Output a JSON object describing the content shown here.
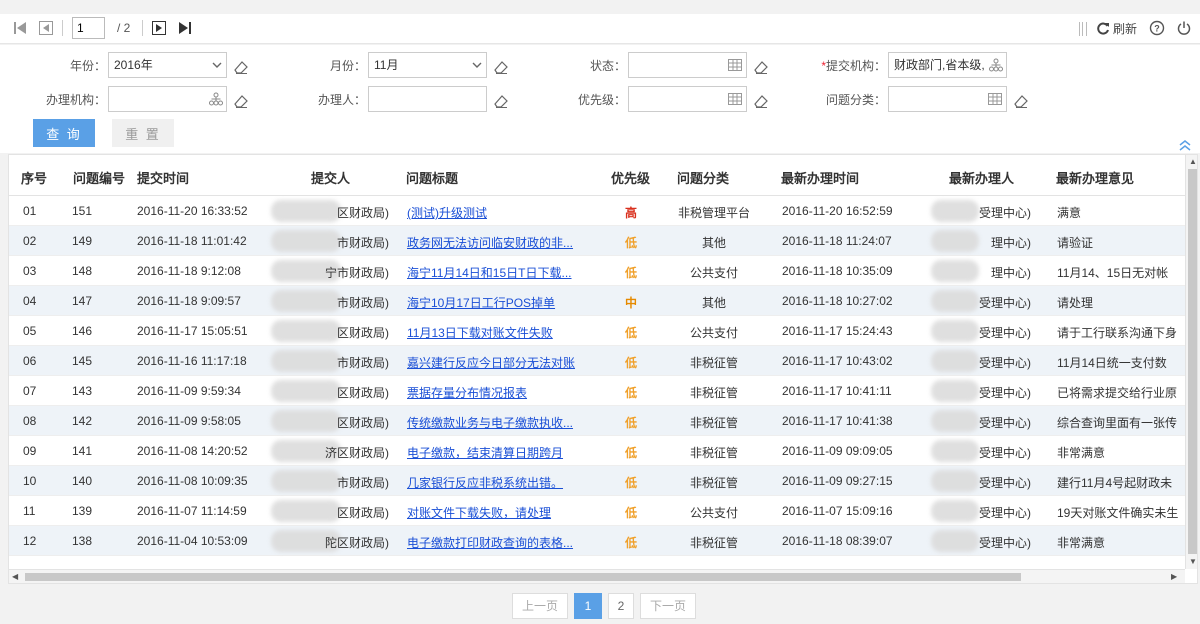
{
  "toolbar": {
    "page_current": "1",
    "page_total": "/ 2",
    "refresh_label": "刷新"
  },
  "filters": {
    "year_label": "年份：",
    "year_value": "2016年",
    "month_label": "月份：",
    "month_value": "11月",
    "status_label": "状态：",
    "status_value": "",
    "submit_org_label": "*提交机构：",
    "submit_org_value": "财政部门,省本级,丿",
    "handle_org_label": "办理机构：",
    "handle_org_value": "",
    "handler_label": "办理人：",
    "handler_value": "",
    "priority_label": "优先级：",
    "priority_value": "",
    "category_label": "问题分类：",
    "category_value": "",
    "query_button": "查 询",
    "reset_button": "重 置"
  },
  "table": {
    "headers": [
      "序号",
      "问题编号",
      "提交时间",
      "提交人",
      "问题标题",
      "优先级",
      "问题分类",
      "最新办理时间",
      "最新办理人",
      "最新办理意见"
    ],
    "rows": [
      {
        "seq": "01",
        "id": "151",
        "time": "2016-11-20 16:33:52",
        "submitter": "区财政局)",
        "title": "(测试)升级测试",
        "priority": "高",
        "pclass": "pri-high",
        "category": "非税管理平台",
        "last_time": "2016-11-20 16:52:59",
        "last_handler": "受理中心)",
        "opinion": "满意"
      },
      {
        "seq": "02",
        "id": "149",
        "time": "2016-11-18 11:01:42",
        "submitter": "市财政局)",
        "title": "政务网无法访问临安财政的非...",
        "priority": "低",
        "pclass": "pri-low",
        "category": "其他",
        "last_time": "2016-11-18 11:24:07",
        "last_handler": "理中心)",
        "opinion": "请验证"
      },
      {
        "seq": "03",
        "id": "148",
        "time": "2016-11-18 9:12:08",
        "submitter": "宁市财政局)",
        "title": "海宁11月14日和15日T日下载...",
        "priority": "低",
        "pclass": "pri-low",
        "category": "公共支付",
        "last_time": "2016-11-18 10:35:09",
        "last_handler": "理中心)",
        "opinion": "11月14、15日无对帐"
      },
      {
        "seq": "04",
        "id": "147",
        "time": "2016-11-18 9:09:57",
        "submitter": "市财政局)",
        "title": "海宁10月17日工行POS掉单",
        "priority": "中",
        "pclass": "pri-mid",
        "category": "其他",
        "last_time": "2016-11-18 10:27:02",
        "last_handler": "受理中心)",
        "opinion": "请处理"
      },
      {
        "seq": "05",
        "id": "146",
        "time": "2016-11-17 15:05:51",
        "submitter": "区财政局)",
        "title": "11月13日下载对账文件失败",
        "priority": "低",
        "pclass": "pri-low",
        "category": "公共支付",
        "last_time": "2016-11-17 15:24:43",
        "last_handler": "受理中心)",
        "opinion": "请于工行联系沟通下身"
      },
      {
        "seq": "06",
        "id": "145",
        "time": "2016-11-16 11:17:18",
        "submitter": "市财政局)",
        "title": "嘉兴建行反应今日部分无法对账",
        "priority": "低",
        "pclass": "pri-low",
        "category": "非税征管",
        "last_time": "2016-11-17 10:43:02",
        "last_handler": "受理中心)",
        "opinion": "11月14日统一支付数"
      },
      {
        "seq": "07",
        "id": "143",
        "time": "2016-11-09 9:59:34",
        "submitter": "区财政局)",
        "title": "票据存量分布情况报表",
        "priority": "低",
        "pclass": "pri-low",
        "category": "非税征管",
        "last_time": "2016-11-17 10:41:11",
        "last_handler": "受理中心)",
        "opinion": "已将需求提交给行业原"
      },
      {
        "seq": "08",
        "id": "142",
        "time": "2016-11-09 9:58:05",
        "submitter": "区财政局)",
        "title": "传统缴款业务与电子缴款执收...",
        "priority": "低",
        "pclass": "pri-low",
        "category": "非税征管",
        "last_time": "2016-11-17 10:41:38",
        "last_handler": "受理中心)",
        "opinion": "综合查询里面有一张传"
      },
      {
        "seq": "09",
        "id": "141",
        "time": "2016-11-08 14:20:52",
        "submitter": "济区财政局)",
        "title": "电子缴款，结束清算日期跨月",
        "priority": "低",
        "pclass": "pri-low",
        "category": "非税征管",
        "last_time": "2016-11-09 09:09:05",
        "last_handler": "受理中心)",
        "opinion": "非常满意"
      },
      {
        "seq": "10",
        "id": "140",
        "time": "2016-11-08 10:09:35",
        "submitter": "市财政局)",
        "title": "几家银行反应非税系统出错。",
        "priority": "低",
        "pclass": "pri-low",
        "category": "非税征管",
        "last_time": "2016-11-09 09:27:15",
        "last_handler": "受理中心)",
        "opinion": "建行11月4号起财政未"
      },
      {
        "seq": "11",
        "id": "139",
        "time": "2016-11-07 11:14:59",
        "submitter": "区财政局)",
        "title": "对账文件下载失败，请处理",
        "priority": "低",
        "pclass": "pri-low",
        "category": "公共支付",
        "last_time": "2016-11-07 15:09:16",
        "last_handler": "受理中心)",
        "opinion": "19天对账文件确实未生"
      },
      {
        "seq": "12",
        "id": "138",
        "time": "2016-11-04 10:53:09",
        "submitter": "陀区财政局)",
        "title": "电子缴款打印财政查询的表格...",
        "priority": "低",
        "pclass": "pri-low",
        "category": "非税征管",
        "last_time": "2016-11-18 08:39:07",
        "last_handler": "受理中心)",
        "opinion": "非常满意"
      }
    ]
  },
  "pager": {
    "prev": "上一页",
    "page1": "1",
    "page2": "2",
    "next": "下一页"
  },
  "colors": {
    "primary": "#5aa0e6",
    "link": "#1a4fd6",
    "priority_high": "#d9301e",
    "priority_mid": "#e68a00",
    "priority_low": "#f0a02a",
    "row_alt": "#eef3f8"
  }
}
